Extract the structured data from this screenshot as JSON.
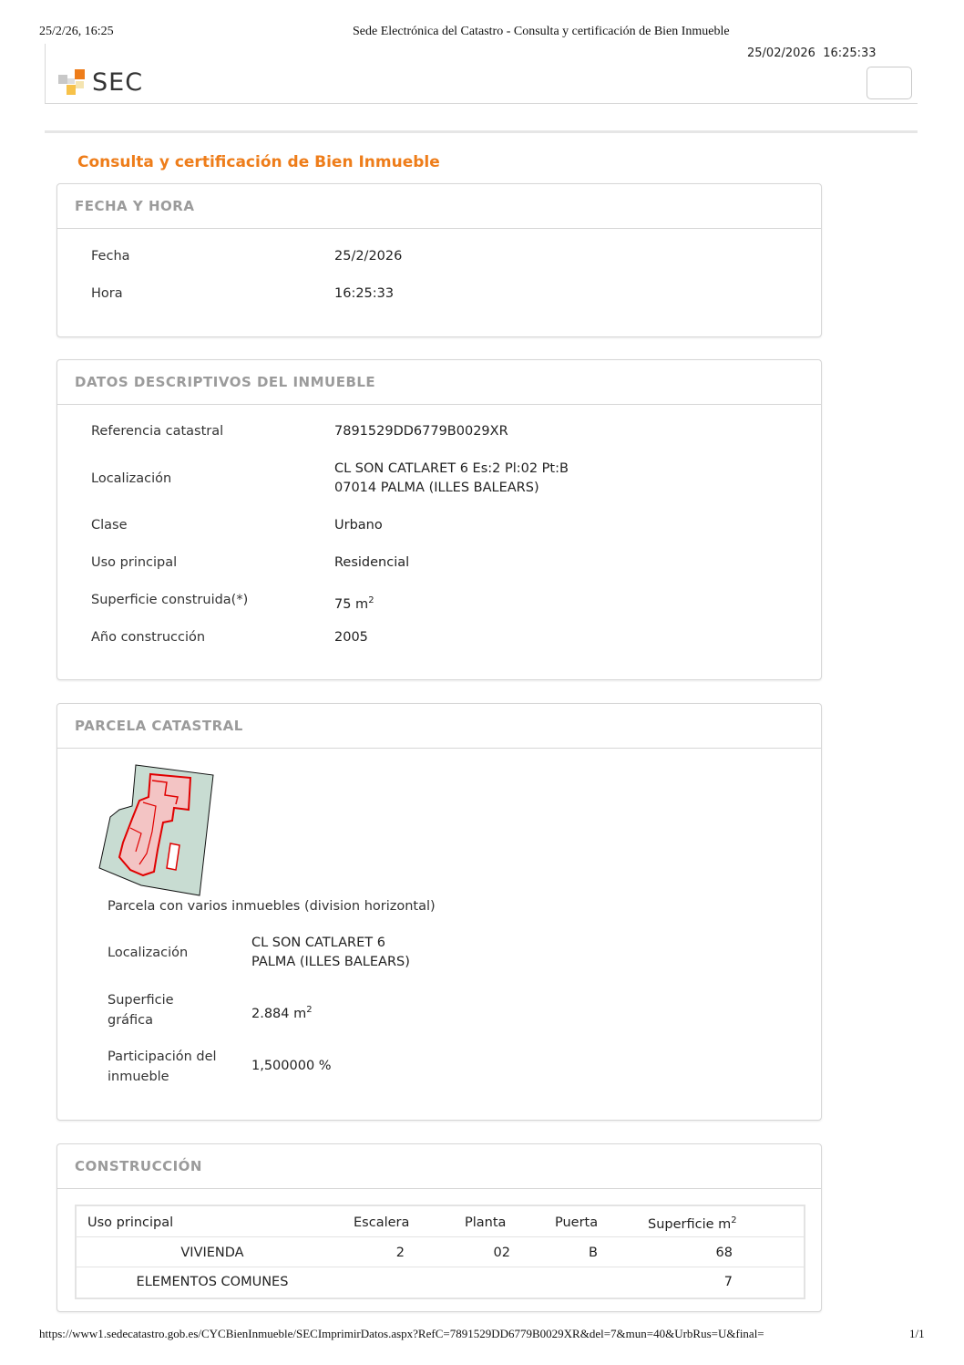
{
  "print_header": {
    "datetime": "25/2/26, 16:25",
    "title": "Sede Electrónica del Catastro - Consulta y certificación de Bien Inmueble"
  },
  "timestamp": "25/02/2026  16:25:33",
  "logo": {
    "text": "SEC",
    "colors": {
      "orange": "#ee7d1a",
      "yellow": "#f7c24a",
      "grey": "#c8c8c8"
    }
  },
  "page_title": "Consulta y certificación de Bien Inmueble",
  "fecha_hora": {
    "title": "FECHA Y HORA",
    "rows": [
      {
        "label": "Fecha",
        "value": "25/2/2026"
      },
      {
        "label": "Hora",
        "value": "16:25:33"
      }
    ]
  },
  "datos": {
    "title": "DATOS DESCRIPTIVOS DEL INMUEBLE",
    "referencia": {
      "label": "Referencia catastral",
      "value": "7891529DD6779B0029XR"
    },
    "localizacion": {
      "label": "Localización",
      "line1": "CL SON CATLARET 6 Es:2 Pl:02 Pt:B",
      "line2": "07014 PALMA (ILLES BALEARS)"
    },
    "clase": {
      "label": "Clase",
      "value": "Urbano"
    },
    "uso": {
      "label": "Uso principal",
      "value": "Residencial"
    },
    "superficie": {
      "label": "Superficie construida(*)",
      "value": "75 m",
      "sup": "2"
    },
    "anio": {
      "label": "Año construcción",
      "value": "2005"
    }
  },
  "parcela": {
    "title": "PARCELA CATASTRAL",
    "caption": "Parcela con varios inmuebles (division horizontal)",
    "localizacion": {
      "label": "Localización",
      "line1": "CL SON CATLARET 6",
      "line2": "PALMA (ILLES BALEARS)"
    },
    "superficie": {
      "label1": "Superficie",
      "label2": "gráfica",
      "value": "2.884 m",
      "sup": "2"
    },
    "participacion": {
      "label1": "Participación del",
      "label2": "inmueble",
      "value": "1,500000 %"
    }
  },
  "construccion": {
    "title": "CONSTRUCCIÓN",
    "headers": {
      "uso": "Uso principal",
      "escalera": "Escalera",
      "planta": "Planta",
      "puerta": "Puerta",
      "superficie": "Superficie m",
      "superficie_sup": "2"
    },
    "rows": [
      {
        "uso": "VIVIENDA",
        "escalera": "2",
        "planta": "02",
        "puerta": "B",
        "superficie": "68"
      },
      {
        "uso": "ELEMENTOS COMUNES",
        "escalera": "",
        "planta": "",
        "puerta": "",
        "superficie": "7"
      }
    ]
  },
  "print_footer": {
    "url": "https://www1.sedecatastro.gob.es/CYCBienInmueble/SECImprimirDatos.aspx?RefC=7891529DD6779B0029XR&del=7&mun=40&UrbRus=U&final=",
    "page": "1/1"
  }
}
